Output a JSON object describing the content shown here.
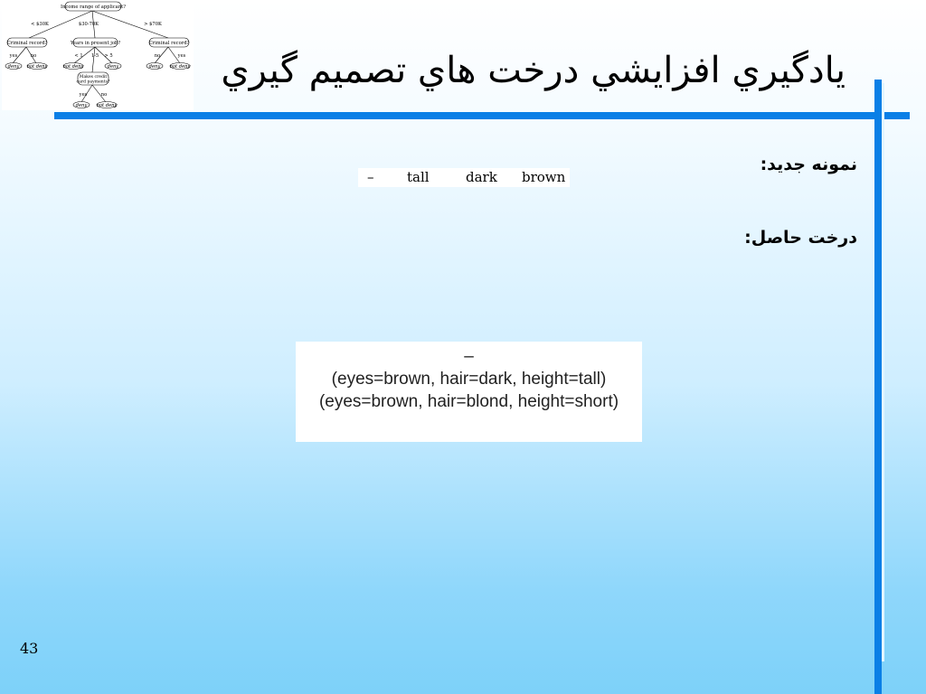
{
  "slide": {
    "title": "يادگيري افزايشي درخت هاي تصميم گيري",
    "page_number": "43",
    "new_sample_label": "نمونه جديد:",
    "result_tree_label": "درخت حاصل:"
  },
  "new_sample": {
    "label": "–",
    "height": "tall",
    "hair": "dark",
    "eyes": "brown"
  },
  "result_tree": {
    "class_symbol": "–",
    "examples": [
      "(eyes=brown, hair=dark, height=tall)",
      "(eyes=brown, hair=blond, height=short)"
    ]
  },
  "logo_tree": {
    "root": "Income range of applicant?",
    "root_branches": [
      "< $30K",
      "$30-70K",
      "> $70K"
    ],
    "left_node": "Criminal record?",
    "middle_node": "Years in present job?",
    "right_node": "Criminal record?",
    "left_branches": [
      "yes",
      "no"
    ],
    "middle_branches": [
      "< 1",
      "1-5",
      "> 5"
    ],
    "right_branches": [
      "no",
      "yes"
    ],
    "left_leaves": [
      "deny",
      "not deny"
    ],
    "middle_leaves": [
      "not deny",
      "deny"
    ],
    "right_leaves": [
      "deny",
      "not deny"
    ],
    "sub_node": "Makes credit card payments?",
    "sub_branches": [
      "yes",
      "no"
    ],
    "sub_leaves": [
      "deny",
      "not deny"
    ]
  },
  "colors": {
    "accent_bar": "#0a7fe6",
    "background_top": "#ffffff",
    "background_bottom": "#7dd1f9"
  }
}
